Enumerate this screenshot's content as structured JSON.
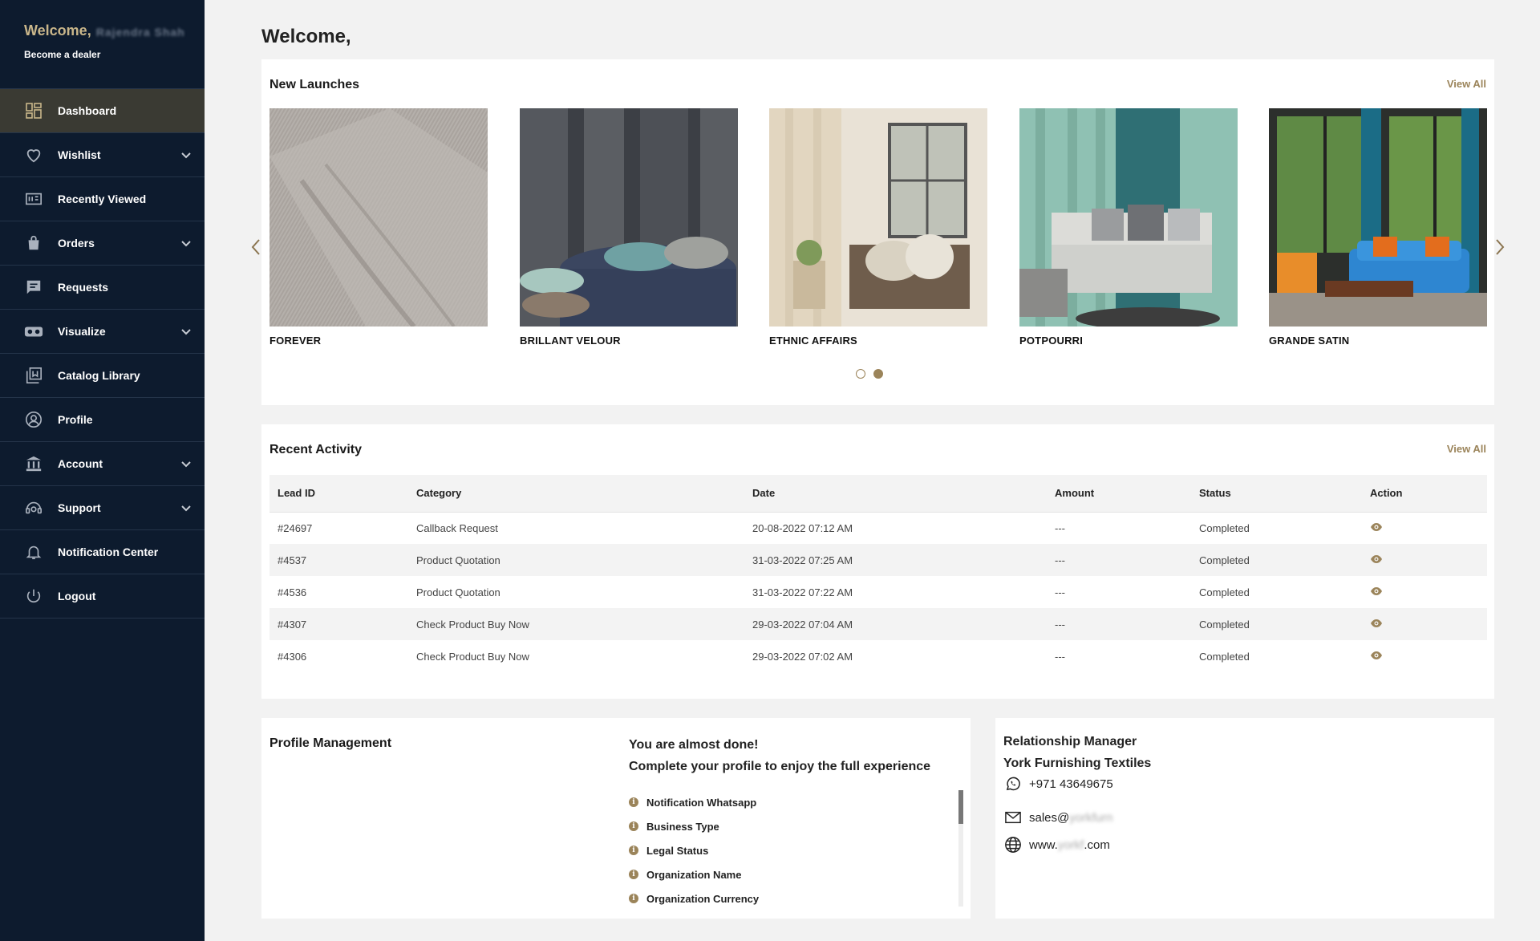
{
  "sidebar": {
    "welcome": "Welcome,",
    "user_name_redacted": "Rajendra Shah",
    "become_dealer": "Become a dealer",
    "items": [
      {
        "label": "Dashboard",
        "icon": "dashboard-icon",
        "active": true
      },
      {
        "label": "Wishlist",
        "icon": "heart-icon",
        "has_submenu": true
      },
      {
        "label": "Recently Viewed",
        "icon": "recently-viewed-icon"
      },
      {
        "label": "Orders",
        "icon": "shopping-bag-icon",
        "has_submenu": true
      },
      {
        "label": "Requests",
        "icon": "chat-icon"
      },
      {
        "label": "Visualize",
        "icon": "vr-headset-icon",
        "has_submenu": true
      },
      {
        "label": "Catalog Library",
        "icon": "library-icon"
      },
      {
        "label": "Profile",
        "icon": "user-icon"
      },
      {
        "label": "Account",
        "icon": "bank-icon",
        "has_submenu": true
      },
      {
        "label": "Support",
        "icon": "support-icon",
        "has_submenu": true
      },
      {
        "label": "Notification Center",
        "icon": "bell-icon"
      },
      {
        "label": "Logout",
        "icon": "power-icon"
      }
    ]
  },
  "main": {
    "title": "Welcome,",
    "new_launches": {
      "title": "New Launches",
      "view_all": "View All",
      "items": [
        {
          "name": "FOREVER"
        },
        {
          "name": "BRILLANT VELOUR"
        },
        {
          "name": "ETHNIC AFFAIRS"
        },
        {
          "name": "POTPOURRI"
        },
        {
          "name": "GRANDE SATIN"
        }
      ],
      "page_count": 2,
      "active_page": 2
    },
    "recent_activity": {
      "title": "Recent Activity",
      "view_all": "View All",
      "columns": [
        "Lead ID",
        "Category",
        "Date",
        "Amount",
        "Status",
        "Action"
      ],
      "rows": [
        [
          "#24697",
          "Callback Request",
          "20-08-2022 07:12 AM",
          "---",
          "Completed"
        ],
        [
          "#4537",
          "Product Quotation",
          "31-03-2022 07:25 AM",
          "---",
          "Completed"
        ],
        [
          "#4536",
          "Product Quotation",
          "31-03-2022 07:22 AM",
          "---",
          "Completed"
        ],
        [
          "#4307",
          "Check Product Buy Now",
          "29-03-2022 07:04 AM",
          "---",
          "Completed"
        ],
        [
          "#4306",
          "Check Product Buy Now",
          "29-03-2022 07:02 AM",
          "---",
          "Completed"
        ]
      ]
    },
    "profile_management": {
      "title": "Profile Management",
      "almost_done": "You are almost done!",
      "complete_msg": "Complete your profile to enjoy the full experience",
      "pending": [
        "Notification Whatsapp",
        "Business Type",
        "Legal Status",
        "Organization Name",
        "Organization Currency"
      ]
    },
    "relationship_manager": {
      "title": "Relationship Manager",
      "company": "York Furnishing Textiles",
      "phone": "+971 43649675",
      "email_prefix": "sales@",
      "email_redacted": "yorkfurn",
      "web_prefix": "www.",
      "web_redacted": "yorkf",
      "web_suffix": ".com"
    }
  },
  "colors": {
    "sidebar_bg": "#0d1b2e",
    "accent_gold": "#9b845a",
    "active_item_bg": "#3a3a33"
  }
}
